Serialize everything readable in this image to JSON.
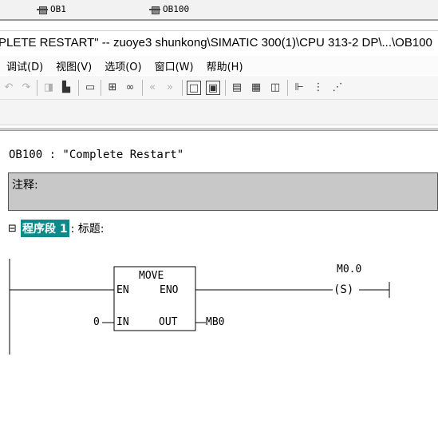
{
  "blocks": [
    {
      "label": "OB1"
    },
    {
      "label": "OB100"
    }
  ],
  "window": {
    "title": "PLETE RESTART\" -- zuoye3 shunkong\\SIMATIC 300(1)\\CPU 313-2 DP\\...\\OB100"
  },
  "menu": [
    {
      "label": "调试(D)"
    },
    {
      "label": "视图(V)"
    },
    {
      "label": "选项(O)"
    },
    {
      "label": "窗口(W)"
    },
    {
      "label": "帮助(H)"
    }
  ],
  "toolbar": {
    "icons": [
      "undo-icon",
      "redo-icon",
      "reference-icon",
      "download-icon",
      "monitor-icon",
      "network-insert-icon",
      "glasses-icon",
      "prev-icon",
      "next-icon",
      "ladder-view-icon",
      "stl-view-icon",
      "fbd-view-icon",
      "overview-icon",
      "details-icon",
      "insert-contact-icon",
      "insert-coil-icon",
      "insert-branch-icon"
    ]
  },
  "editor": {
    "block_title": "OB100 :  \"Complete Restart\"",
    "comment_label": "注释:",
    "network": {
      "toggle": "⊟",
      "label": "程序段 1",
      "title": ": 标题:"
    }
  },
  "ladder": {
    "box_name": "MOVE",
    "en": "EN",
    "eno": "ENO",
    "in_pin": "IN",
    "out_pin": "OUT",
    "in_value": "0",
    "out_value": "MB0",
    "coil_address": "M0.0",
    "coil_symbol": "(S)"
  }
}
